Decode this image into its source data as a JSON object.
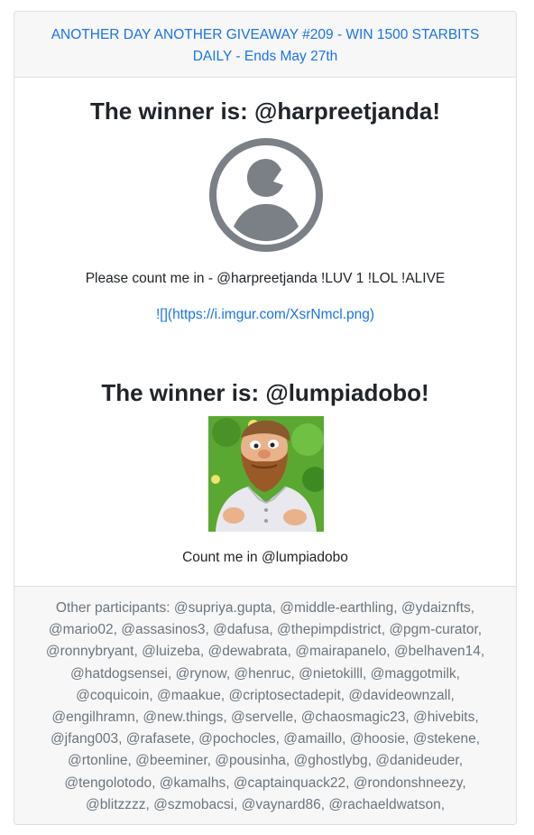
{
  "header": {
    "giveaway_link": "ANOTHER DAY ANOTHER GIVEAWAY #209 - WIN 1500 STARBITS DAILY - Ends May 27th"
  },
  "winners": [
    {
      "title": "The winner is: @harpreetjanda!",
      "avatar_icon": "user-circle-icon",
      "comment": "Please count me in - @harpreetjanda !LUV 1 !LOL !ALIVE",
      "link_text": "![](https://i.imgur.com/XsrNmcl.png)"
    },
    {
      "title": "The winner is: @lumpiadobo!",
      "avatar_icon": "bearded-man-avatar",
      "comment": "Count me in @lumpiadobo"
    }
  ],
  "footer": {
    "participants_text": "Other participants: @supriya.gupta, @middle-earthling, @ydaiznfts, @mario02, @assasinos3, @dafusa, @thepimpdistrict, @pgm-curator, @ronnybryant, @luizeba, @dewabrata, @mairapanelo, @belhaven14, @hatdogsensei, @rynow, @henruc, @nietokilll, @maggotmilk, @coquicoin, @maakue, @criptosectadepit, @davideownzall, @engilhramn, @new.things, @servelle, @chaosmagic23, @hivebits, @jfang003, @rafasete, @pochocles, @amaillo, @hoosie, @stekene, @rtonline, @beeminer, @pousinha, @ghostlybg, @danideuder, @tengolotodo, @kamalhs, @captainquack22, @rondonshneezy, @blitzzzz, @szmobacsi, @vaynard86, @rachaeldwatson,"
  },
  "colors": {
    "link": "#1a73e8",
    "muted": "#6c757d",
    "header_bg": "#f7f7f7",
    "border": "#dfdfdf",
    "avatar_gray": "#7b8087"
  }
}
